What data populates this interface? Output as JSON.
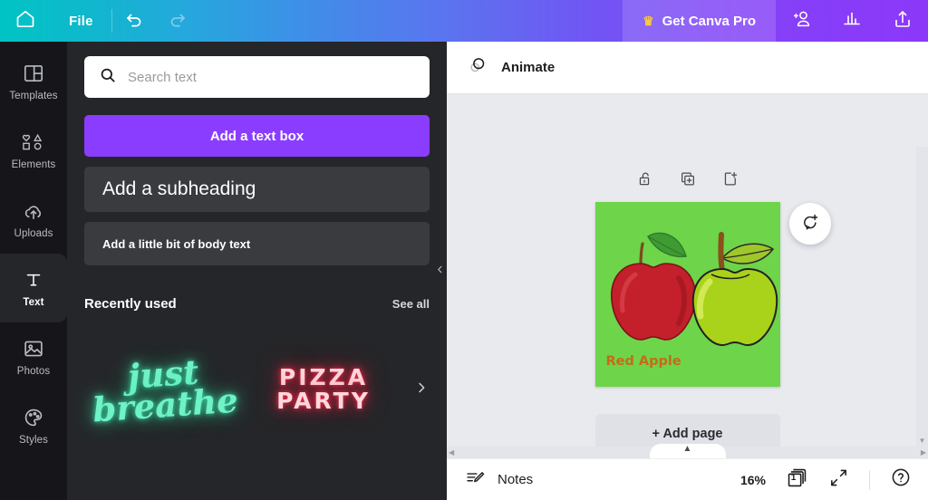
{
  "topbar": {
    "home_icon": "home-icon",
    "file_label": "File",
    "undo_icon": "undo-icon",
    "redo_icon": "redo-icon",
    "pro_label": "Get Canva Pro",
    "crown_icon": "crown-icon",
    "share_people_icon": "add-collaborator-icon",
    "insights_icon": "bar-chart-icon",
    "publish_icon": "upload-share-icon",
    "gradient_start": "#00c4c4",
    "gradient_end": "#8b38f8"
  },
  "sidebar": {
    "items": [
      {
        "label": "Templates",
        "icon": "templates-icon",
        "active": false
      },
      {
        "label": "Elements",
        "icon": "elements-icon",
        "active": false
      },
      {
        "label": "Uploads",
        "icon": "uploads-cloud-icon",
        "active": false
      },
      {
        "label": "Text",
        "icon": "text-t-icon",
        "active": true
      },
      {
        "label": "Photos",
        "icon": "photos-image-icon",
        "active": false
      },
      {
        "label": "Styles",
        "icon": "styles-palette-icon",
        "active": false
      }
    ]
  },
  "panel": {
    "search": {
      "placeholder": "Search text",
      "value": "",
      "icon": "search-icon"
    },
    "add_text_box_label": "Add a text box",
    "add_text_box_color": "#8b3dff",
    "subheading_label": "Add a subheading",
    "body_text_label": "Add a little bit of body text",
    "recently_used_title": "Recently used",
    "see_all_label": "See all",
    "thumbnails": [
      {
        "text": "just\nbreathe",
        "style": "neon-green",
        "color": "#6ff2c6"
      },
      {
        "text": "PIZZA\nPARTY",
        "style": "neon-red",
        "color": "#ffd9dd"
      }
    ],
    "next_arrow_icon": "chevron-right-icon",
    "collapse_icon": "chevron-left-icon"
  },
  "editor": {
    "animate_label": "Animate",
    "animate_icon": "animate-circles-icon",
    "page_tools": [
      {
        "name": "lock-page",
        "icon": "unlock-icon"
      },
      {
        "name": "duplicate-page",
        "icon": "duplicate-page-icon"
      },
      {
        "name": "add-page",
        "icon": "add-page-icon"
      }
    ],
    "comment_icon": "add-comment-icon",
    "page": {
      "background_color": "#6ed44a",
      "caption": "Red Apple",
      "caption_color": "#c86a18",
      "red_apple_color": "#c4202b",
      "green_apple_color": "#a9d21b"
    },
    "add_page_label": "+ Add page",
    "scroll_left_icon": "triangle-left-icon",
    "scroll_right_icon": "triangle-right-icon",
    "scroll_down_icon": "triangle-down-icon",
    "notes_handle_icon": "chevron-up-icon"
  },
  "bottombar": {
    "notes_label": "Notes",
    "notes_icon": "notes-pencil-icon",
    "zoom_level": "16%",
    "page_count": "1",
    "pages_icon": "page-stack-icon",
    "fullscreen_icon": "expand-arrows-icon",
    "help_label": "?",
    "help_icon": "help-circle-icon"
  }
}
